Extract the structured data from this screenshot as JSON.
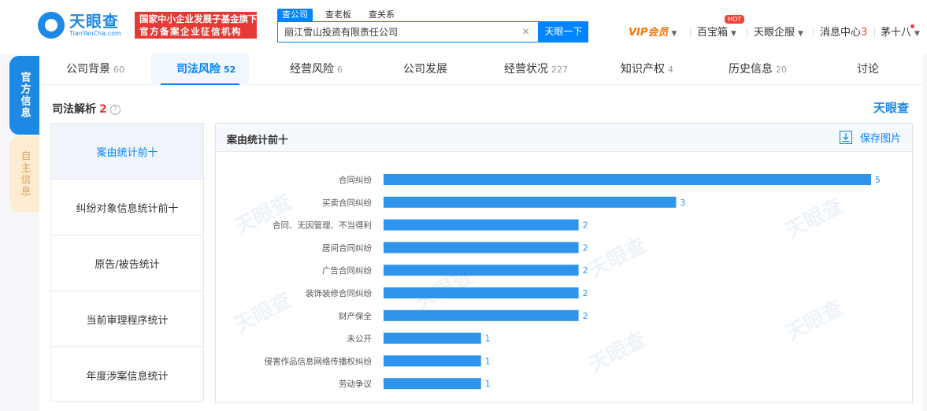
{
  "header": {
    "logo_cn": "天眼查",
    "logo_en": "TianYanCha.com",
    "banner_line1": "国家中小企业发展子基金旗下",
    "banner_line2": "官方备案企业征信机构",
    "search_tabs": [
      "查公司",
      "查老板",
      "查关系"
    ],
    "search_value": "丽江雪山投资有限责任公司",
    "search_button": "天眼一下",
    "vip": "VIP会员",
    "treasure": "百宝箱",
    "hot": "HOT",
    "enterprise": "天眼企服",
    "messages": "消息中心",
    "message_count": "3",
    "user": "茅十八"
  },
  "side_tabs": {
    "official": "官方信息",
    "self": "自主信息"
  },
  "tabs": [
    {
      "label": "公司背景",
      "count": "60"
    },
    {
      "label": "司法风险",
      "count": "52"
    },
    {
      "label": "经营风险",
      "count": "6"
    },
    {
      "label": "公司发展",
      "count": ""
    },
    {
      "label": "经营状况",
      "count": "227"
    },
    {
      "label": "知识产权",
      "count": "4"
    },
    {
      "label": "历史信息",
      "count": "20"
    },
    {
      "label": "讨论",
      "count": ""
    }
  ],
  "section": {
    "title": "司法解析",
    "count": "2",
    "help": "?",
    "brand": "天眼查"
  },
  "left_menu": [
    "案由统计前十",
    "纠纷对象信息统计前十",
    "原告/被告统计",
    "当前审理程序统计",
    "年度涉案信息统计"
  ],
  "chart_panel": {
    "title": "案由统计前十",
    "save_label": "保存图片"
  },
  "watermark_text": "天眼查",
  "colors": {
    "accent": "#0084ff",
    "bar": "#2f95ec",
    "brand": "#1e88e5",
    "red": "#e53935"
  },
  "chart_data": {
    "type": "bar",
    "orientation": "horizontal",
    "categories": [
      "合同纠纷",
      "买卖合同纠纷",
      "合同、无因管理、不当得利",
      "居间合同纠纷",
      "广告合同纠纷",
      "装饰装修合同纠纷",
      "财产保全",
      "未公开",
      "侵害作品信息网络传播权纠纷",
      "劳动争议"
    ],
    "values": [
      5,
      3,
      2,
      2,
      2,
      2,
      2,
      1,
      1,
      1
    ],
    "title": "案由统计前十",
    "xlim": [
      0,
      5
    ],
    "grid": false,
    "legend": "none"
  }
}
